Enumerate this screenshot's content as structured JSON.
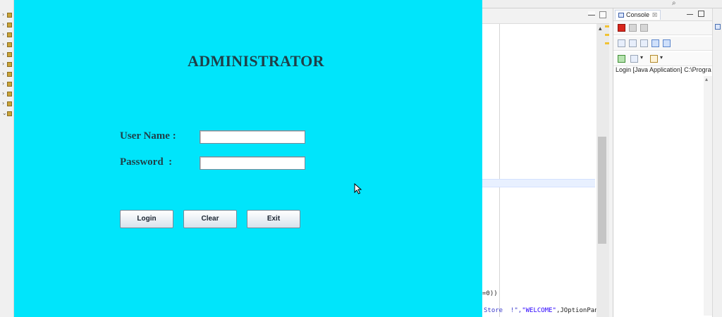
{
  "login": {
    "title": "ADMINISTRATOR",
    "username_label": "User Name :",
    "username_value": "",
    "password_label": "Password  :",
    "password_value": "",
    "buttons": {
      "login": "Login",
      "clear": "Clear",
      "exit": "Exit"
    },
    "background_color": "#00e5fb"
  },
  "ide": {
    "console_tab": "Console",
    "console_tab_close": "☒",
    "process_label": "Login [Java Application] C:\\Progra",
    "code_line_1": "=0))",
    "code_line_2_a": "Store  !\",",
    "code_line_2_b": "\"WELCOME\"",
    "code_line_2_c": ",JOptionPan"
  }
}
